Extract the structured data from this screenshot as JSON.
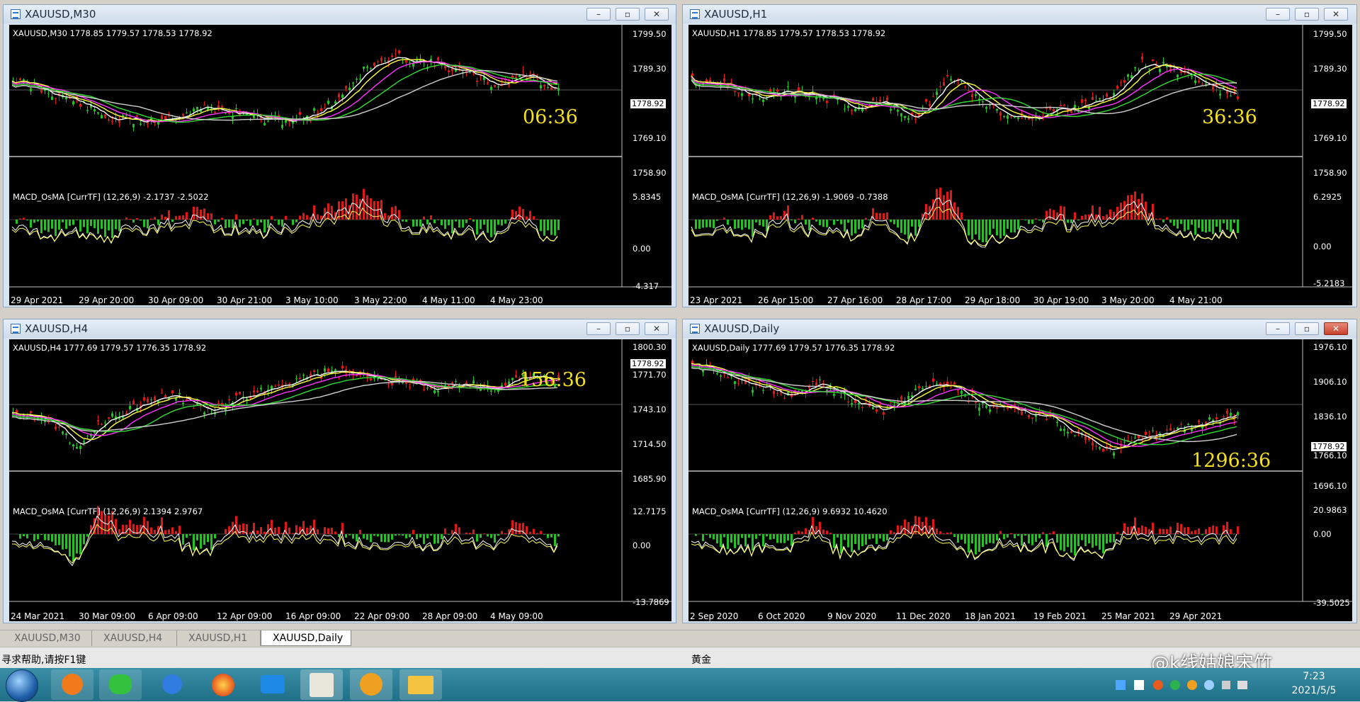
{
  "windows": [
    {
      "title": "XAUUSD,M30",
      "header": "XAUUSD,M30  1778.85 1779.57 1778.53 1778.92",
      "prices": [
        "1799.50",
        "1789.30",
        "1769.10",
        "1758.90"
      ],
      "current": "1778.92",
      "timer": "06:36",
      "macd": "MACD_OsMA [CurrTF] (12,26,9) -2.1737 -2.5022",
      "macd_scale": [
        "5.8345",
        "0.00",
        "-4.317"
      ],
      "xlabels": [
        "29 Apr 2021",
        "29 Apr 20:00",
        "30 Apr 09:00",
        "30 Apr 21:00",
        "3 May 10:00",
        "3 May 22:00",
        "4 May 11:00",
        "4 May 23:00"
      ]
    },
    {
      "title": "XAUUSD,H1",
      "header": "XAUUSD,H1  1778.85 1779.57 1778.53 1778.92",
      "prices": [
        "1799.50",
        "1789.30",
        "1769.10",
        "1758.90"
      ],
      "current": "1778.92",
      "timer": "36:36",
      "macd": "MACD_OsMA [CurrTF] (12,26,9) -1.9069 -0.7388",
      "macd_scale": [
        "6.2925",
        "0.00",
        "-5.2183"
      ],
      "xlabels": [
        "23 Apr 2021",
        "26 Apr 15:00",
        "27 Apr 16:00",
        "28 Apr 17:00",
        "29 Apr 18:00",
        "30 Apr 19:00",
        "3 May 20:00",
        "4 May 21:00"
      ]
    },
    {
      "title": "XAUUSD,H4",
      "header": "XAUUSD,H4  1777.69 1779.57 1776.35 1778.92",
      "prices": [
        "1800.30",
        "1771.70",
        "1743.10",
        "1714.50",
        "1685.90"
      ],
      "current": "1778.92",
      "timer": "156:36",
      "macd": "MACD_OsMA [CurrTF] (12,26,9) 2.1394 2.9767",
      "macd_scale": [
        "12.7175",
        "0.00",
        "-13.7869"
      ],
      "xlabels": [
        "24 Mar 2021",
        "30 Mar 09:00",
        "6 Apr 09:00",
        "12 Apr 09:00",
        "16 Apr 09:00",
        "22 Apr 09:00",
        "28 Apr 09:00",
        "4 May 09:00"
      ]
    },
    {
      "title": "XAUUSD,Daily",
      "header": "XAUUSD,Daily  1777.69 1779.57 1776.35 1778.92",
      "prices": [
        "1976.10",
        "1906.10",
        "1836.10",
        "1766.10",
        "1696.10"
      ],
      "current": "1778.92",
      "timer": "1296:36",
      "macd": "MACD_OsMA [CurrTF] (12,26,9) 9.6932 10.4620",
      "macd_scale": [
        "20.9863",
        "0.00",
        "-39.5025"
      ],
      "xlabels": [
        "2 Sep 2020",
        "6 Oct 2020",
        "9 Nov 2020",
        "11 Dec 2020",
        "18 Jan 2021",
        "19 Feb 2021",
        "25 Mar 2021",
        "29 Apr 2021"
      ]
    }
  ],
  "tabs": [
    "XAUUSD,M30",
    "XAUUSD,H4",
    "XAUUSD,H1",
    "XAUUSD,Daily"
  ],
  "status": {
    "help": "寻求帮助,请按F1键",
    "symbol": "黄金"
  },
  "watermark": "@k线姑娘宋竹",
  "clock": {
    "time": "7:23",
    "date": "2021/5/5"
  },
  "colors": {
    "bull": "#22c322",
    "bear": "#e01818",
    "timer": "#f5e020"
  },
  "icons": [
    "start-orb",
    "browser",
    "wechat",
    "pen",
    "firefox",
    "app",
    "app2",
    "app3",
    "folder"
  ]
}
